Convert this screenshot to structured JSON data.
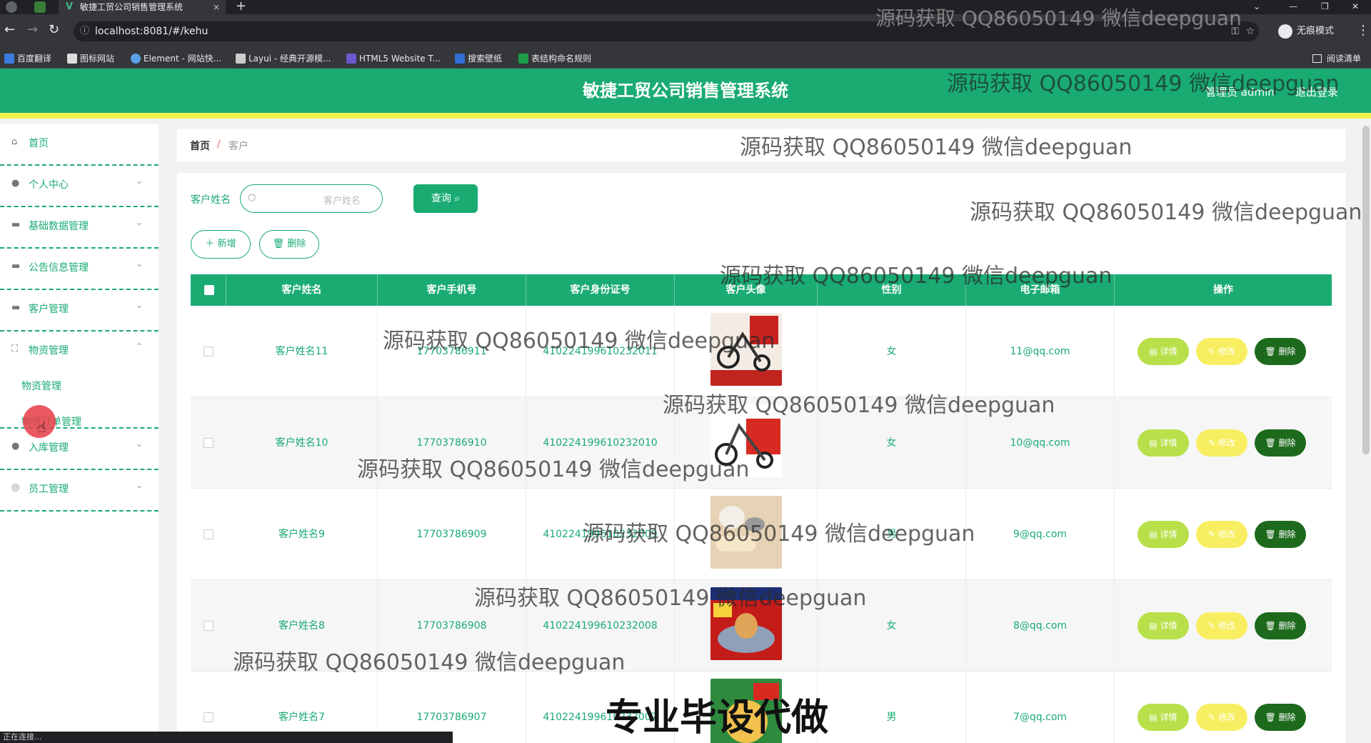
{
  "browser": {
    "tab_title": "敏捷工贸公司销售管理系统",
    "tab_close": "×",
    "new_tab": "+",
    "url": "localhost:8081/#/kehu",
    "incognito_label": "无痕模式",
    "bookmarks": [
      "百度翻译",
      "图标网站",
      "Element - 网站快...",
      "Layui - 经典开源模...",
      "HTML5 Website T...",
      "搜索壁纸",
      "表结构命名规则"
    ],
    "reading_list": "阅读清单",
    "status_text": "正在连接..."
  },
  "header": {
    "title": "敏捷工贸公司销售管理系统",
    "user": "管理员 admin",
    "logout": "退出登录"
  },
  "sidebar": {
    "items": [
      {
        "label": "首页",
        "icon": "home-icon"
      },
      {
        "label": "个人中心",
        "icon": "user-icon"
      },
      {
        "label": "基础数据管理",
        "icon": "data-icon"
      },
      {
        "label": "公告信息管理",
        "icon": "notice-icon"
      },
      {
        "label": "客户管理",
        "icon": "customer-icon"
      },
      {
        "label": "物资管理",
        "icon": "goods-icon"
      },
      {
        "label": "入库管理",
        "icon": "inbound-icon"
      },
      {
        "label": "员工管理",
        "icon": "staff-icon"
      }
    ],
    "submenu": [
      "物资管理",
      "物资订单管理"
    ]
  },
  "breadcrumb": {
    "home": "首页",
    "sep": "/",
    "current": "客户"
  },
  "search": {
    "label": "客户姓名",
    "placeholder": "客户姓名",
    "query_label": "查询"
  },
  "actions": {
    "add": "新增",
    "delete": "删除"
  },
  "table": {
    "headers": [
      "客户姓名",
      "客户手机号",
      "客户身份证号",
      "客户头像",
      "性别",
      "电子邮箱",
      "操作"
    ],
    "rows": [
      {
        "name": "客户姓名11",
        "phone": "17703786911",
        "id": "410224199610232011",
        "gender": "女",
        "email": "11@qq.com"
      },
      {
        "name": "客户姓名10",
        "phone": "17703786910",
        "id": "410224199610232010",
        "gender": "女",
        "email": "10@qq.com"
      },
      {
        "name": "客户姓名9",
        "phone": "17703786909",
        "id": "410224199610232009",
        "gender": "男",
        "email": "9@qq.com"
      },
      {
        "name": "客户姓名8",
        "phone": "17703786908",
        "id": "410224199610232008",
        "gender": "女",
        "email": "8@qq.com"
      },
      {
        "name": "客户姓名7",
        "phone": "17703786907",
        "id": "410224199610232007",
        "gender": "男",
        "email": "7@qq.com"
      }
    ],
    "row_actions": {
      "detail": "详情",
      "edit": "修改",
      "delete": "删除"
    }
  },
  "watermark": {
    "text": "源码获取 QQ86050149 微信deepguan",
    "big": "专业毕设代做"
  }
}
